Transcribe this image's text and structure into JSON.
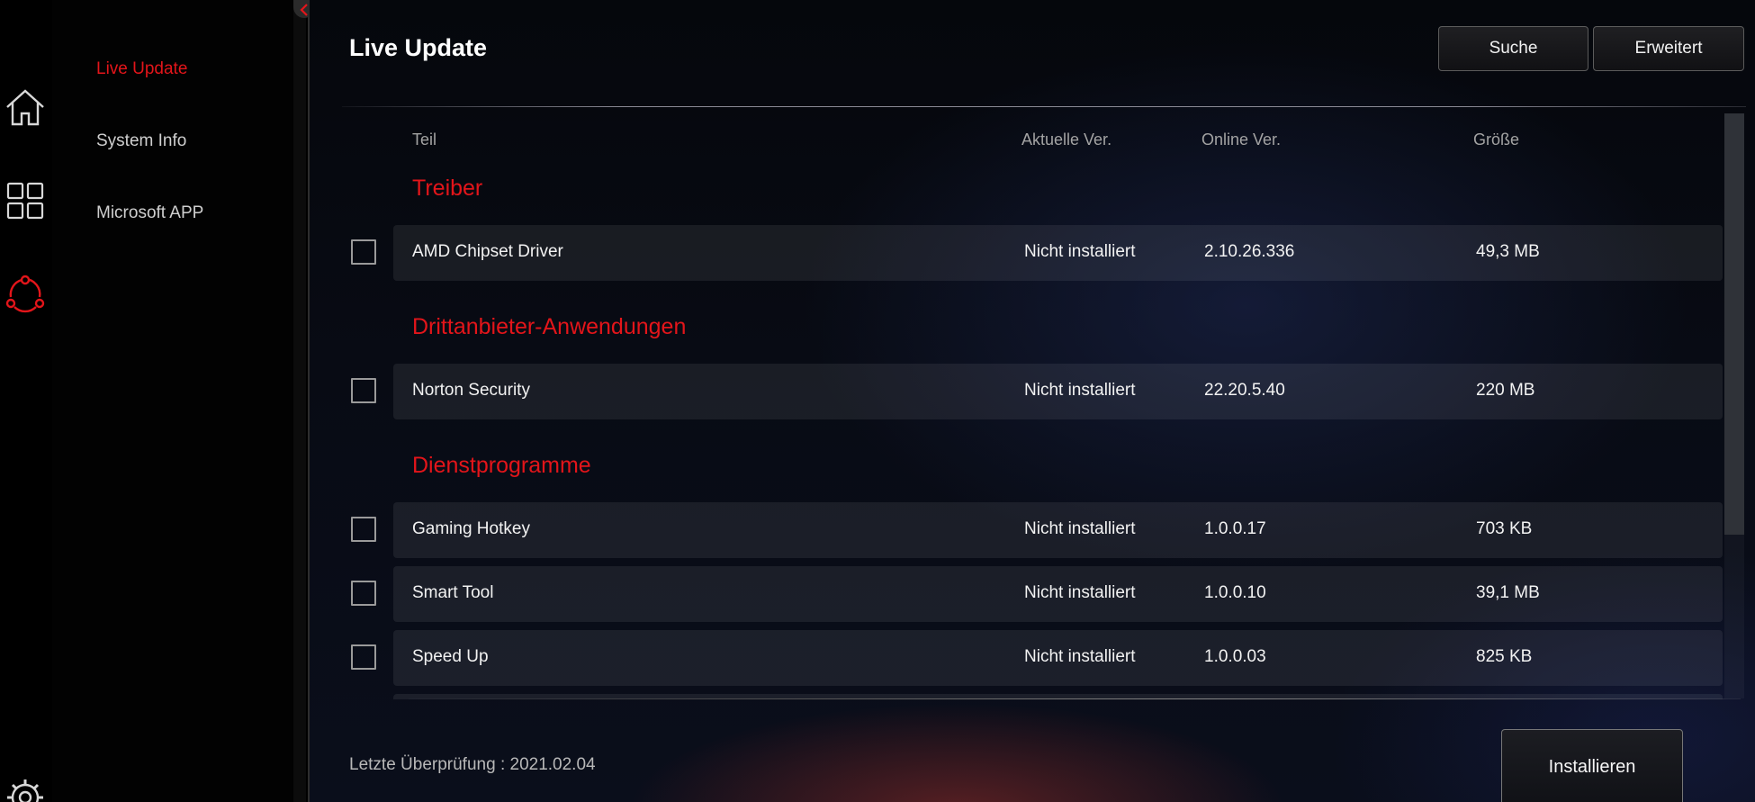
{
  "rail": {
    "icons": [
      "home-icon",
      "apps-grid-icon",
      "live-update-icon",
      "settings-gear-icon"
    ],
    "active": "live-update-icon",
    "accent_color": "#e3151a"
  },
  "subnav": {
    "items": [
      {
        "label": "Live Update",
        "active": true
      },
      {
        "label": "System Info",
        "active": false
      },
      {
        "label": "Microsoft APP",
        "active": false
      }
    ]
  },
  "header": {
    "title": "Live Update",
    "buttons": {
      "search_label": "Suche",
      "advanced_label": "Erweitert"
    }
  },
  "table": {
    "columns": {
      "part": "Teil",
      "current": "Aktuelle Ver.",
      "online": "Online Ver.",
      "size": "Größe"
    },
    "sections": [
      {
        "title": "Treiber",
        "items": [
          {
            "name": "AMD Chipset Driver",
            "current": "Nicht installiert",
            "online": "2.10.26.336",
            "size": "49,3 MB",
            "checked": false
          }
        ]
      },
      {
        "title": "Drittanbieter-Anwendungen",
        "items": [
          {
            "name": "Norton Security",
            "current": "Nicht installiert",
            "online": "22.20.5.40",
            "size": "220 MB",
            "checked": false
          }
        ]
      },
      {
        "title": "Dienstprogramme",
        "items": [
          {
            "name": "Gaming Hotkey",
            "current": "Nicht installiert",
            "online": "1.0.0.17",
            "size": "703 KB",
            "checked": false
          },
          {
            "name": "Smart Tool",
            "current": "Nicht installiert",
            "online": "1.0.0.10",
            "size": "39,1 MB",
            "checked": false
          },
          {
            "name": "Speed Up",
            "current": "Nicht installiert",
            "online": "1.0.0.03",
            "size": "825 KB",
            "checked": false
          }
        ]
      }
    ]
  },
  "footer": {
    "last_check": "Letzte Überprüfung : 2021.02.04",
    "install_label": "Installieren"
  }
}
